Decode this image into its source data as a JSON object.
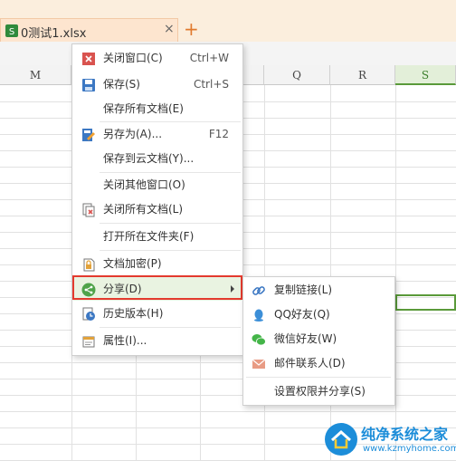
{
  "tab": {
    "title": "0测试1.xlsx",
    "close": "×",
    "new_tab": "+"
  },
  "columns": [
    "M",
    "",
    "",
    "",
    "Q",
    "R",
    "S"
  ],
  "menu": {
    "items": [
      {
        "label": "关闭窗口(C)",
        "shortcut": "Ctrl+W",
        "icon": "close-window-icon"
      },
      {
        "label": "保存(S)",
        "shortcut": "Ctrl+S",
        "icon": "save-icon"
      },
      {
        "label": "保存所有文档(E)",
        "shortcut": "",
        "icon": ""
      },
      {
        "label": "另存为(A)...",
        "shortcut": "F12",
        "icon": "save-as-icon"
      },
      {
        "label": "保存到云文档(Y)...",
        "shortcut": "",
        "icon": ""
      },
      {
        "label": "关闭其他窗口(O)",
        "shortcut": "",
        "icon": ""
      },
      {
        "label": "关闭所有文档(L)",
        "shortcut": "",
        "icon": "close-all-icon"
      },
      {
        "label": "打开所在文件夹(F)",
        "shortcut": "",
        "icon": ""
      },
      {
        "label": "文档加密(P)",
        "shortcut": "",
        "icon": "encrypt-icon"
      },
      {
        "label": "分享(D)",
        "shortcut": "",
        "icon": "share-icon"
      },
      {
        "label": "历史版本(H)",
        "shortcut": "",
        "icon": "history-icon"
      },
      {
        "label": "属性(I)...",
        "shortcut": "",
        "icon": "properties-icon"
      }
    ]
  },
  "submenu": {
    "items": [
      {
        "label": "复制链接(L)",
        "icon": "link-icon"
      },
      {
        "label": "QQ好友(Q)",
        "icon": "qq-icon"
      },
      {
        "label": "微信好友(W)",
        "icon": "wechat-icon"
      },
      {
        "label": "邮件联系人(D)",
        "icon": "mail-icon"
      },
      {
        "label": "设置权限并分享(S)",
        "icon": ""
      }
    ]
  },
  "watermark": {
    "title": "纯净系统之家",
    "url": "www.kzmyhome.com"
  },
  "colors": {
    "accent_green": "#5a9a3a",
    "highlight_red": "#e33a2e",
    "tab_bg": "#fde5cf"
  }
}
